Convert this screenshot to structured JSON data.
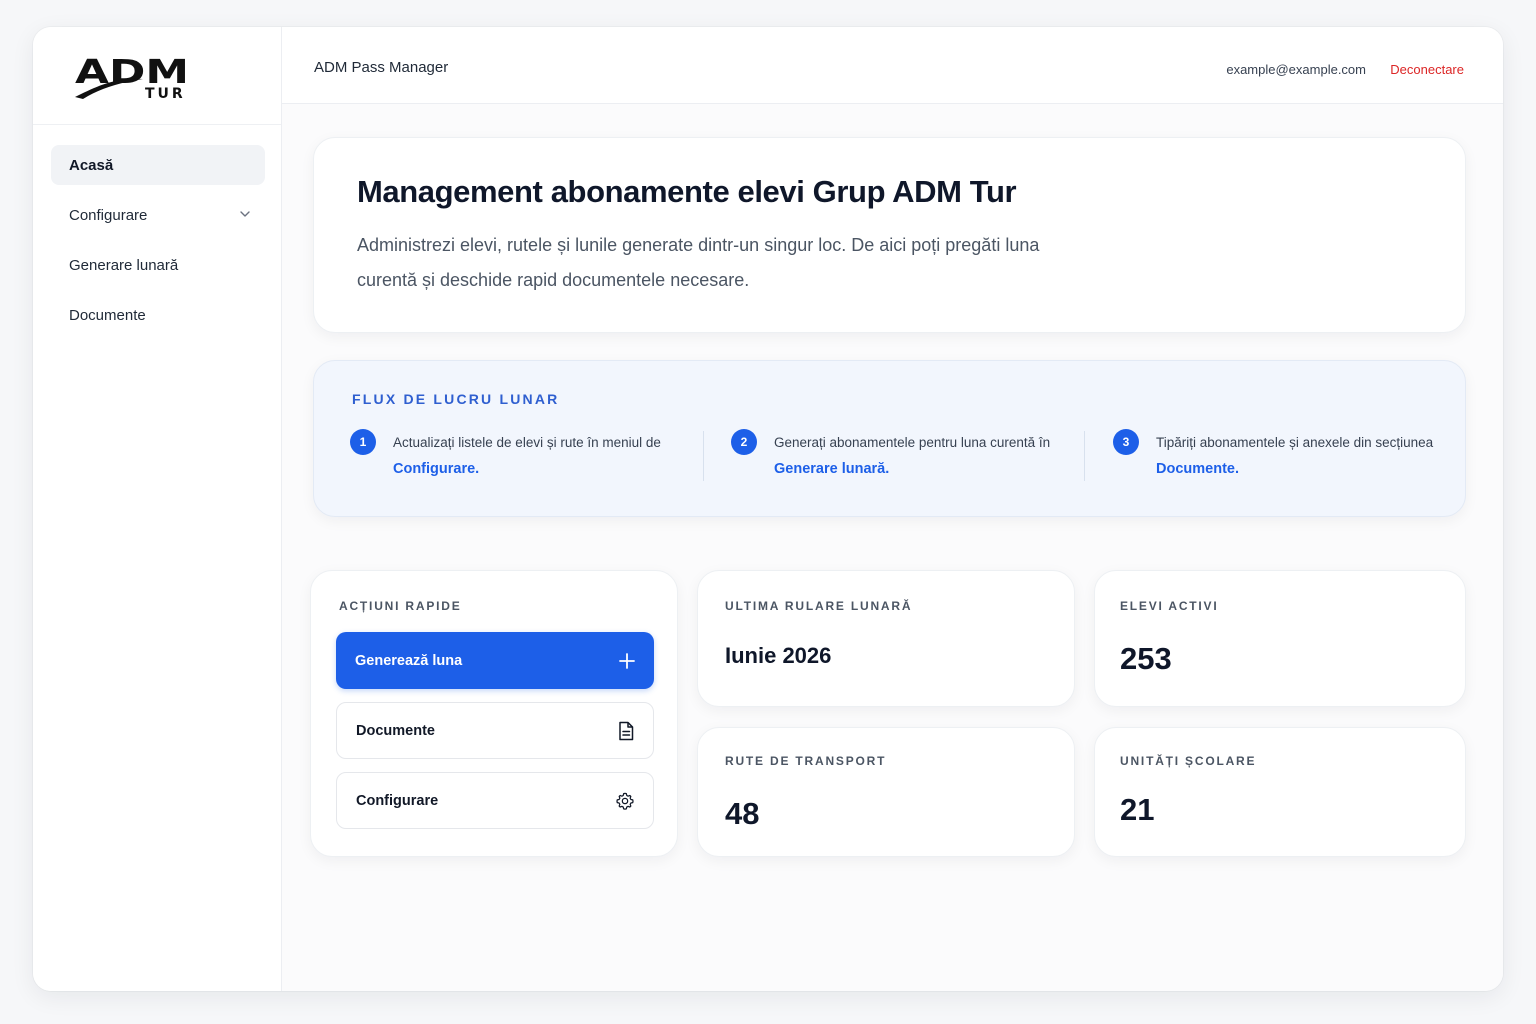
{
  "brand": {
    "logo_main": "ADM",
    "logo_sub": "TUR"
  },
  "sidebar": {
    "items": [
      {
        "label": "Acasă",
        "active": true
      },
      {
        "label": "Configurare",
        "has_submenu": true
      },
      {
        "label": "Generare lunară"
      },
      {
        "label": "Documente"
      }
    ]
  },
  "header": {
    "app_title": "ADM Pass Manager",
    "user_email": "example@example.com",
    "logout_label": "Deconectare"
  },
  "hero": {
    "title": "Management abonamente elevi Grup ADM Tur",
    "description": "Administrezi elevi, rutele și lunile generate dintr-un singur loc. De aici poți pregăti luna curentă și deschide rapid documentele necesare."
  },
  "workflow": {
    "title": "FLUX DE LUCRU LUNAR",
    "steps": [
      {
        "number": "1",
        "text": "Actualizați listele de elevi și rute în meniul de",
        "link": "Configurare."
      },
      {
        "number": "2",
        "text": "Generați abonamentele pentru luna curentă în",
        "link": "Generare lunară."
      },
      {
        "number": "3",
        "text": "Tipăriți abonamentele și anexele din secțiunea",
        "link": "Documente."
      }
    ]
  },
  "quick_actions": {
    "title": "ACȚIUNI RAPIDE",
    "buttons": [
      {
        "label": "Generează luna",
        "icon": "plus-icon"
      },
      {
        "label": "Documente",
        "icon": "document-icon"
      },
      {
        "label": "Configurare",
        "icon": "gear-icon"
      }
    ]
  },
  "stats": {
    "last_run": {
      "label": "ULTIMA RULARE LUNARĂ",
      "value": "Iunie 2026"
    },
    "active_students": {
      "label": "ELEVI ACTIVI",
      "value": "253"
    },
    "routes": {
      "label": "RUTE DE TRANSPORT",
      "value": "48"
    },
    "schools": {
      "label": "UNITĂȚI ȘCOLARE",
      "value": "21"
    }
  },
  "colors": {
    "accent": "#1d5fe8",
    "danger": "#dc2626",
    "workflow_bg": "#f2f6fd"
  }
}
